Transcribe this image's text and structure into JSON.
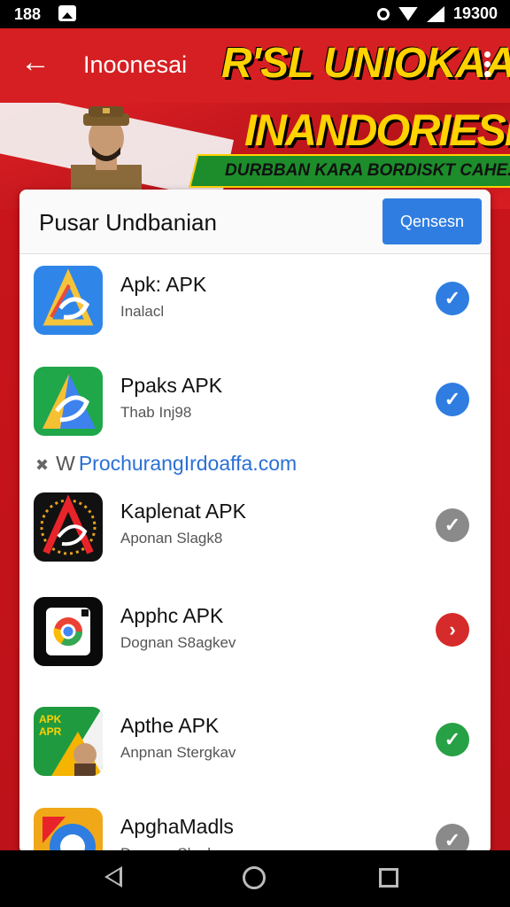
{
  "status_bar": {
    "time_left": "188",
    "time_right": "19300"
  },
  "app_bar": {
    "title": "Inoonesai",
    "brand": "R'SL UNIOKAA"
  },
  "banner": {
    "headline": "INANDORIESIA",
    "tagline": "DURBBAN KARA BORDISKT CAHE...!"
  },
  "card": {
    "title": "Pusar Undbanian",
    "header_button": "Qensesn",
    "url": "ProchurangIrdoaffa.com",
    "url_prefix": "W",
    "items": [
      {
        "name": "Apk: APK",
        "sub": "Inalacl",
        "status": "ok",
        "status_color": "#2f7de1"
      },
      {
        "name": "Ppaks APK",
        "sub": "Thab Inj98",
        "status": "ok",
        "status_color": "#2f7de1"
      },
      {
        "name": "Kaplenat APK",
        "sub": "Aponan Slagk8",
        "status": "ok",
        "status_color": "#8a8a8a"
      },
      {
        "name": "Apphc APK",
        "sub": "Dognan S8agkev",
        "status": "error",
        "status_color": "#d62b2b"
      },
      {
        "name": "Apthe APK",
        "sub": "Anpnan Stergkav",
        "status": "ok",
        "status_color": "#27a145"
      },
      {
        "name": "ApghaMadls",
        "sub": "Dognan Slagkev",
        "status": "ok",
        "status_color": "#8a8a8a"
      }
    ]
  },
  "nav": {
    "back": "back-icon",
    "home": "home-icon",
    "recent": "recent-apps-icon"
  }
}
